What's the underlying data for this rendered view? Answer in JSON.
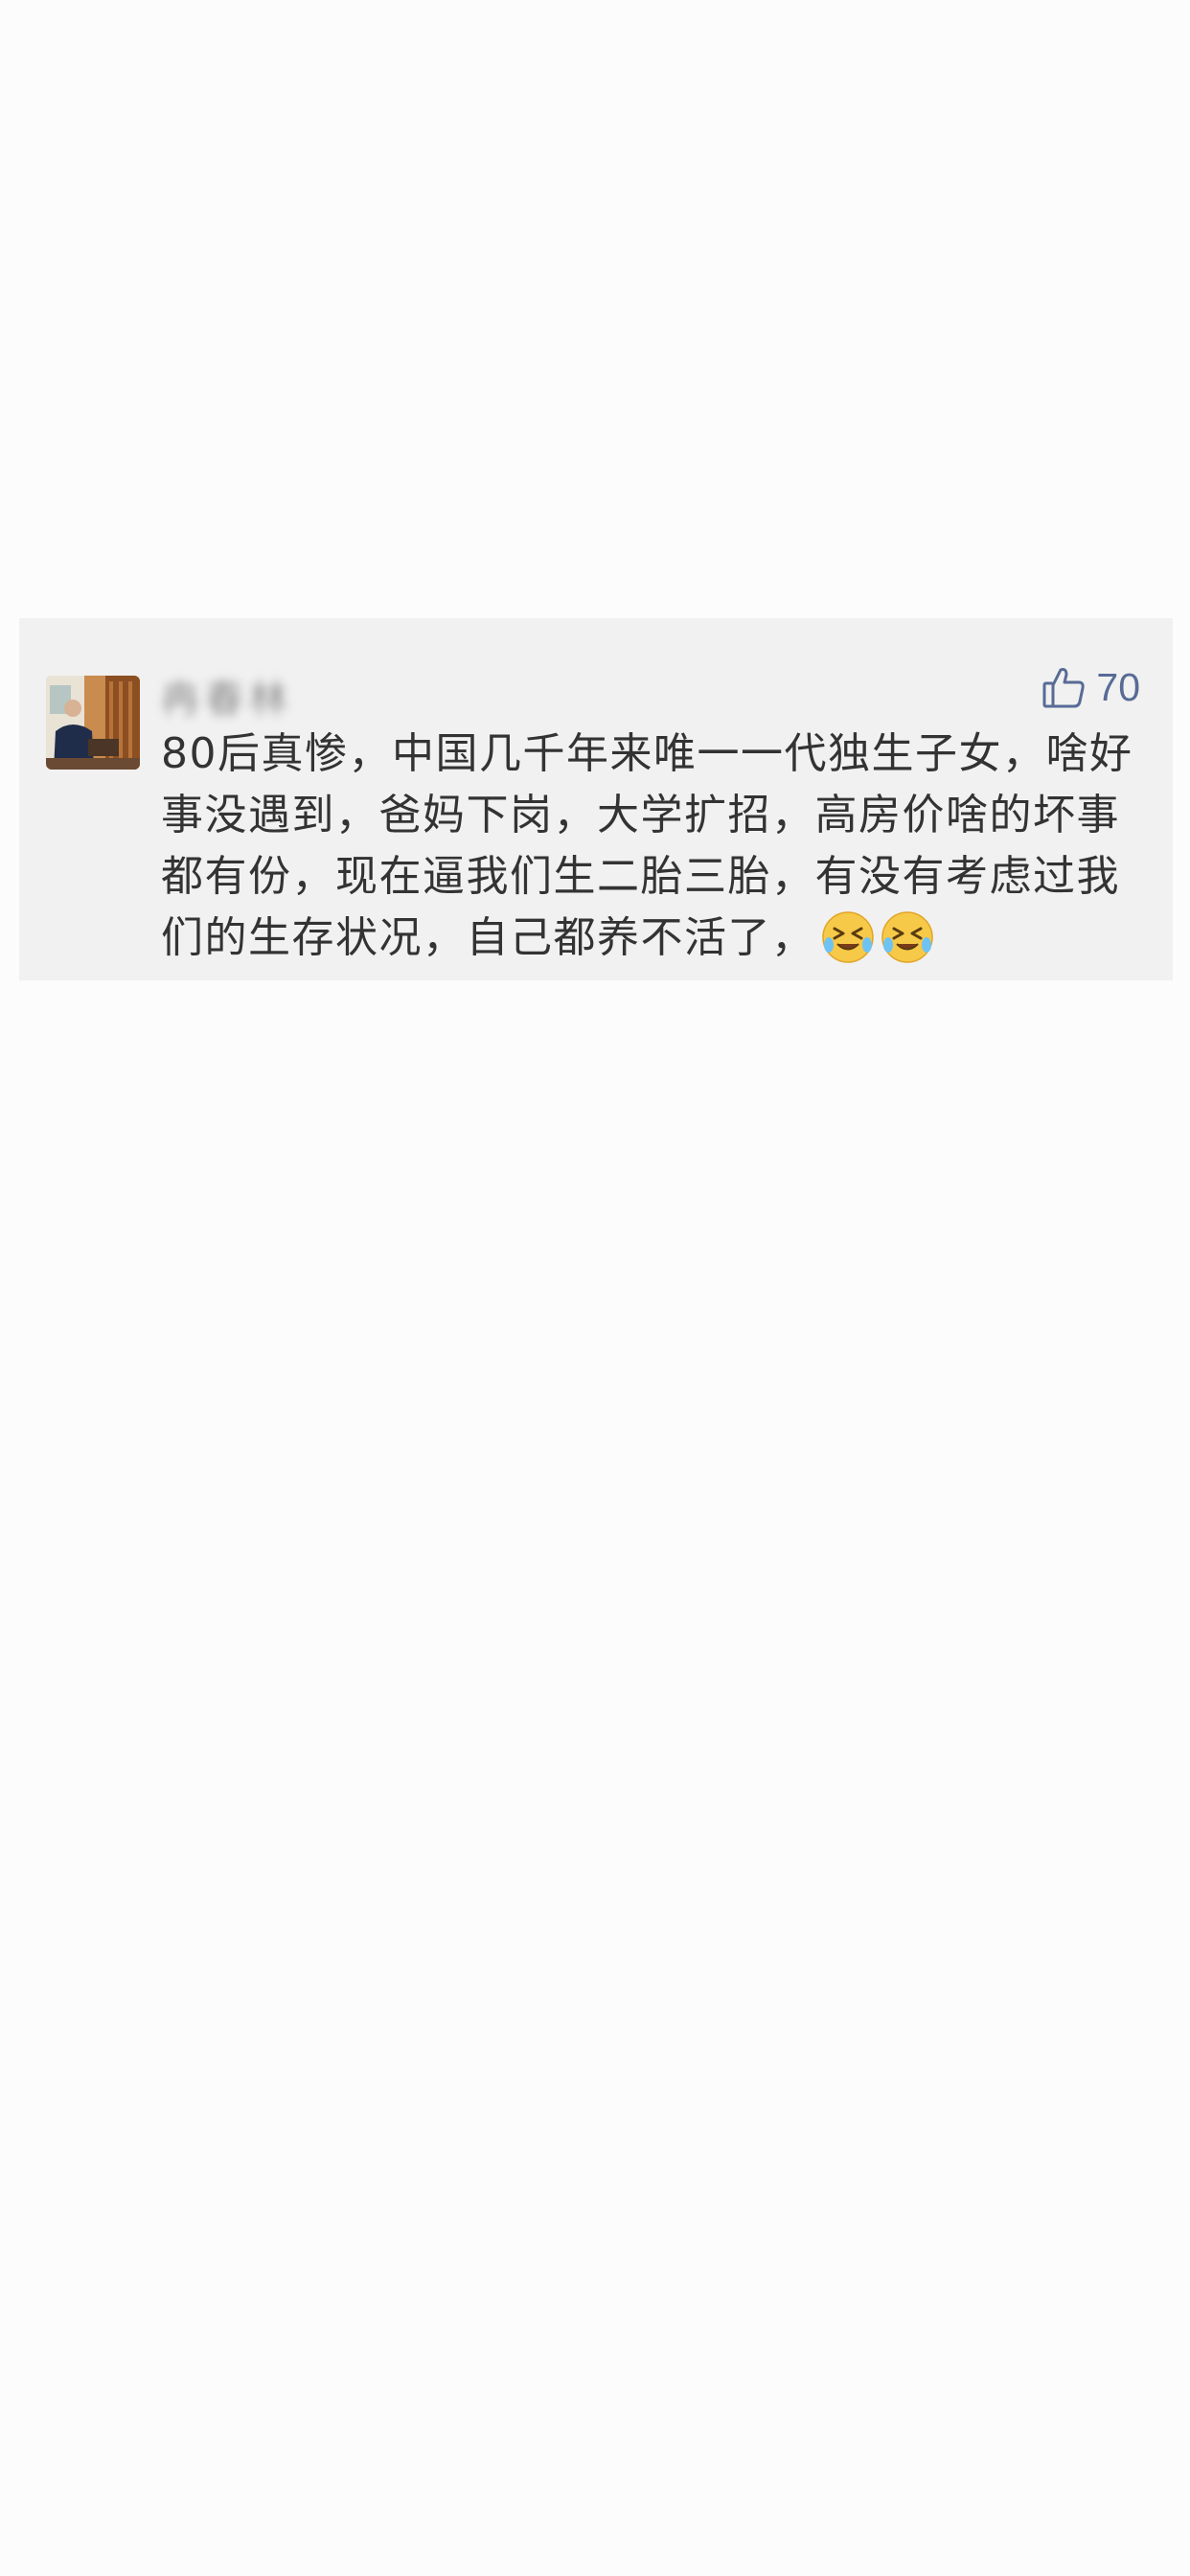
{
  "comment": {
    "username": "冉春林",
    "like_count": "70",
    "text": "80后真惨，中国几千年来唯一一代独生子女，啥好事没遇到，爸妈下岗，大学扩招，高房价啥的坏事都有份，现在逼我们生二胎三胎，有没有考虑过我们的生存状况，自己都养不活了，",
    "emojis": [
      "crying-laughing-emoji",
      "crying-laughing-emoji"
    ],
    "colors": {
      "like_accent": "#576b95",
      "text": "#333333",
      "card_background": "#f1f1f1",
      "page_background": "#fcfcfc"
    }
  }
}
